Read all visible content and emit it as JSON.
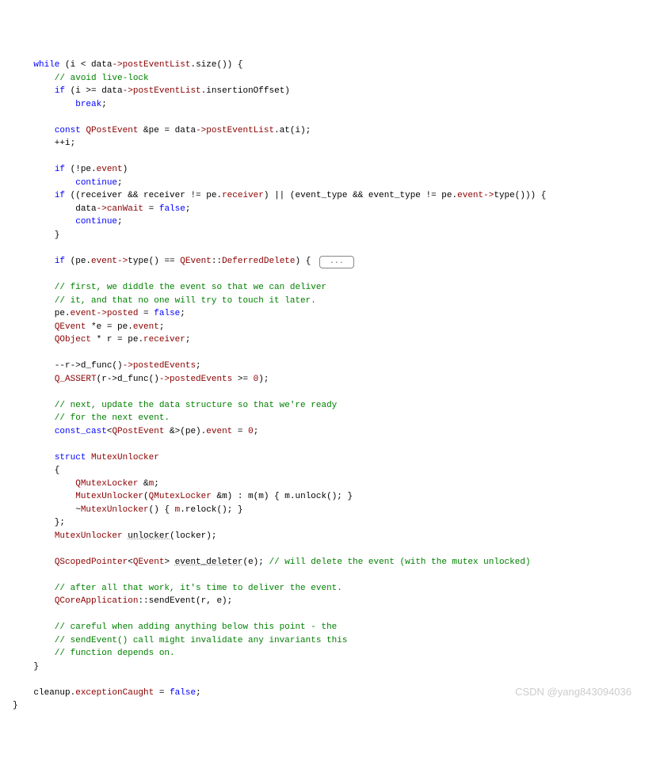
{
  "code": {
    "l1a": "    ",
    "l1b": "while",
    "l1c": " (i < data",
    "l1d": "->",
    "l1e": "postEventList",
    "l1f": ".size()) {",
    "l2": "        // avoid live-lock",
    "l3a": "        ",
    "l3b": "if",
    "l3c": " (i >= data",
    "l3d": "->",
    "l3e": "postEventList",
    "l3f": ".insertionOffset)",
    "l4a": "            ",
    "l4b": "break",
    "l4c": ";",
    "l5": "",
    "l6a": "        ",
    "l6b": "const",
    "l6c": " ",
    "l6d": "QPostEvent",
    "l6e": " &pe = data",
    "l6f": "->",
    "l6g": "postEventList",
    "l6h": ".at(i);",
    "l7": "        ++i;",
    "l8": "",
    "l9a": "        ",
    "l9b": "if",
    "l9c": " (!pe.",
    "l9d": "event",
    "l9e": ")",
    "l10a": "            ",
    "l10b": "continue",
    "l10c": ";",
    "l11a": "        ",
    "l11b": "if",
    "l11c": " ((receiver && receiver != pe.",
    "l11d": "receiver",
    "l11e": ") || (event_type && event_type != pe.",
    "l11f": "event",
    "l11g": "->",
    "l11h": "type())) {",
    "l12a": "            data",
    "l12b": "->",
    "l12c": "canWait",
    "l12d": " = ",
    "l12e": "false",
    "l12f": ";",
    "l13a": "            ",
    "l13b": "continue",
    "l13c": ";",
    "l14": "        }",
    "l15": "",
    "l16a": "        ",
    "l16b": "if",
    "l16c": " (pe.",
    "l16d": "event",
    "l16e": "->",
    "l16f": "type() == ",
    "l16g": "QEvent",
    "l16h": "::",
    "l16i": "DeferredDelete",
    "l16j": ") { ",
    "l16fold": "...",
    "l17": "",
    "l18": "        // first, we diddle the event so that we can deliver",
    "l19": "        // it, and that no one will try to touch it later.",
    "l20a": "        pe.",
    "l20b": "event",
    "l20c": "->",
    "l20d": "posted",
    "l20e": " = ",
    "l20f": "false",
    "l20g": ";",
    "l21a": "        ",
    "l21b": "QEvent",
    "l21c": " *e = pe.",
    "l21d": "event",
    "l21e": ";",
    "l22a": "        ",
    "l22b": "QObject",
    "l22c": " * r = pe.",
    "l22d": "receiver",
    "l22e": ";",
    "l23": "",
    "l24a": "        --r->d_func()",
    "l24b": "->",
    "l24c": "postedEvents",
    "l24d": ";",
    "l25a": "        ",
    "l25b": "Q_ASSERT",
    "l25c": "(r->d_func()",
    "l25d": "->",
    "l25e": "postedEvents",
    "l25f": " >= ",
    "l25g": "0",
    "l25h": ");",
    "l26": "",
    "l27": "        // next, update the data structure so that we're ready",
    "l28": "        // for the next event.",
    "l29a": "        ",
    "l29b": "const_cast",
    "l29c": "<",
    "l29d": "QPostEvent",
    "l29e": " &>(pe).",
    "l29f": "event",
    "l29g": " = ",
    "l29h": "0",
    "l29i": ";",
    "l30": "",
    "l31a": "        ",
    "l31b": "struct",
    "l31c": " ",
    "l31d": "MutexUnlocker",
    "l32": "        {",
    "l33a": "            ",
    "l33b": "QMutexLocker",
    "l33c": " &",
    "l33d": "m",
    "l33e": ";",
    "l34a": "            ",
    "l34b": "MutexUnlocker",
    "l34c": "(",
    "l34d": "QMutexLocker",
    "l34e": " &m) : m(m) { m.unlock(); }",
    "l35a": "            ~",
    "l35b": "MutexUnlocker",
    "l35c": "() { ",
    "l35d": "m",
    "l35e": ".relock(); }",
    "l36": "        };",
    "l37a": "        ",
    "l37b": "MutexUnlocker",
    "l37c": " ",
    "l37d": "unlocker",
    "l37e": "(locker);",
    "l38": "",
    "l39a": "        ",
    "l39b": "QScopedPointer",
    "l39c": "<",
    "l39d": "QEvent",
    "l39e": "> ",
    "l39f": "event_deleter",
    "l39g": "(e); ",
    "l39h": "// will delete the event (with the mutex unlocked)",
    "l40": "",
    "l41": "        // after all that work, it's time to deliver the event.",
    "l42a": "        ",
    "l42b": "QCoreApplication",
    "l42c": "::sendEvent(r, e);",
    "l43": "",
    "l44": "        // careful when adding anything below this point - the",
    "l45": "        // sendEvent() call might invalidate any invariants this",
    "l46": "        // function depends on.",
    "l47": "    }",
    "l48": "",
    "l49a": "    cleanup.",
    "l49b": "exceptionCaught",
    "l49c": " = ",
    "l49d": "false",
    "l49e": ";",
    "l50": "}"
  },
  "watermark": "CSDN @yang843094036"
}
